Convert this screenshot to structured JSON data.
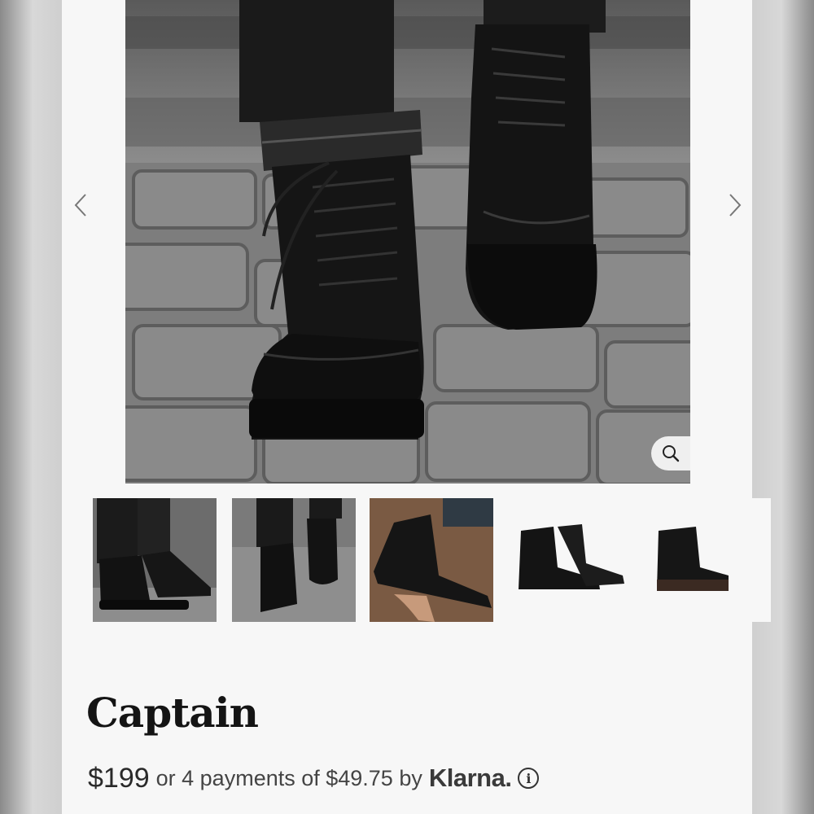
{
  "product": {
    "title": "Captain",
    "price": "$199",
    "installments_text": "or 4 payments of $49.75 by",
    "payment_provider": "Klarna."
  },
  "gallery": {
    "main_image_alt": "boots-on-cobblestone",
    "thumbnails": [
      "boots-worn-side",
      "boots-walking-cobblestone",
      "boot-in-hand",
      "boots-pair-studio",
      "boot-single-studio"
    ],
    "zoom_icon": "search-icon",
    "prev_icon": "chevron-left-icon",
    "next_icon": "chevron-right-icon"
  },
  "colors": {
    "background": "#f7f7f7",
    "text": "#141414"
  }
}
